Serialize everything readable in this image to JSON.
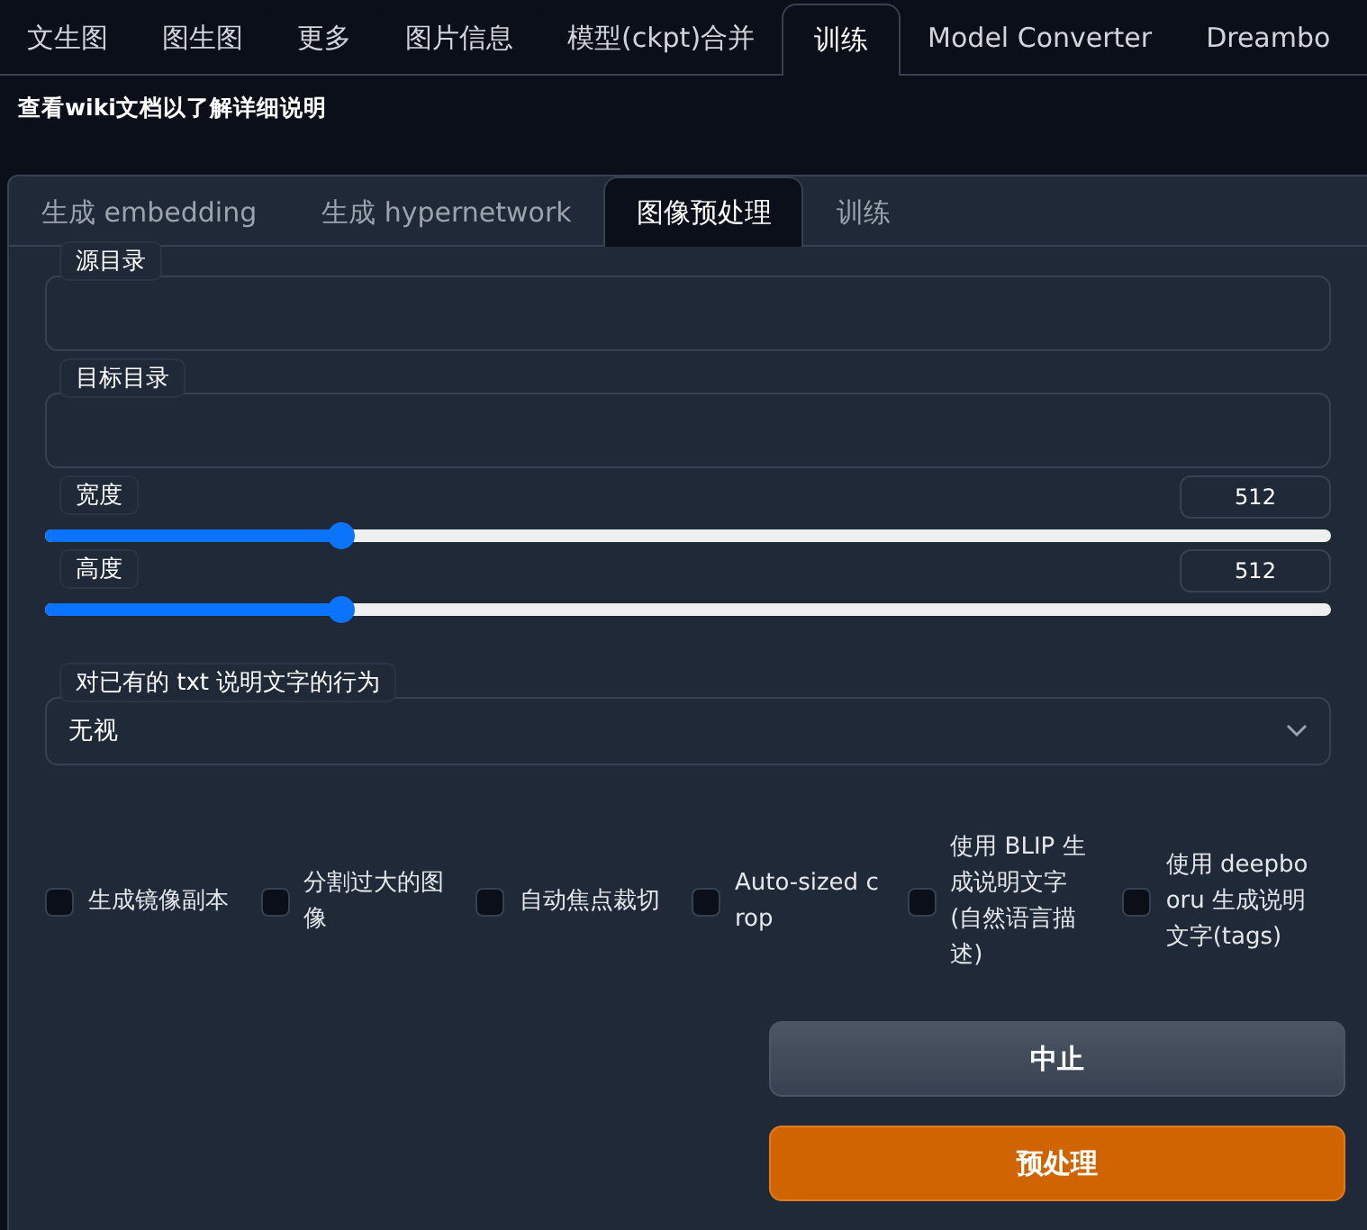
{
  "top_tabs": [
    {
      "label": "文生图",
      "selected": false
    },
    {
      "label": "图生图",
      "selected": false
    },
    {
      "label": "更多",
      "selected": false
    },
    {
      "label": "图片信息",
      "selected": false
    },
    {
      "label": "模型(ckpt)合并",
      "selected": false
    },
    {
      "label": "训练",
      "selected": true
    },
    {
      "label": "Model Converter",
      "selected": false
    },
    {
      "label": "Dreambo",
      "selected": false
    }
  ],
  "info_text": "查看wiki文档以了解详细说明",
  "sub_tabs": [
    {
      "label": "生成 embedding",
      "selected": false
    },
    {
      "label": "生成 hypernetwork",
      "selected": false
    },
    {
      "label": "图像预处理",
      "selected": true
    },
    {
      "label": "训练",
      "selected": false
    }
  ],
  "fields": [
    {
      "label": "源目录"
    },
    {
      "label": "目标目录"
    }
  ],
  "sliders": [
    {
      "label": "宽度",
      "value": "512",
      "level": 0.23
    },
    {
      "label": "高度",
      "value": "512",
      "level": 0.23
    }
  ],
  "dropdown": {
    "label": "对已有的 txt 说明文字的行为",
    "value": "无视"
  },
  "checkboxes": [
    {
      "label": "生成镜像副本",
      "checked": false
    },
    {
      "label": "分割过大的图像",
      "checked": false
    },
    {
      "label": "自动焦点裁切",
      "checked": false
    },
    {
      "label": "Auto-sized crop",
      "checked": false
    },
    {
      "label": "使用 BLIP 生成说明文字(自然语言描述)",
      "checked": false
    },
    {
      "label": "使用 deepbooru 生成说明文字(tags)",
      "checked": false
    }
  ],
  "buttons": [
    {
      "label": "中止",
      "kind": "secondary"
    },
    {
      "label": "预处理",
      "kind": "primary"
    }
  ]
}
